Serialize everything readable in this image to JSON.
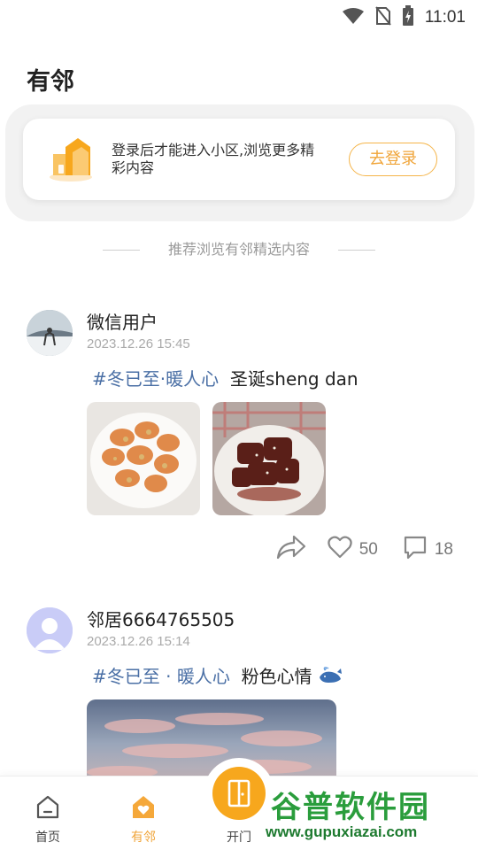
{
  "status_bar": {
    "time": "11:01",
    "icons": [
      "wifi-icon",
      "no-sim-icon",
      "battery-charging-icon"
    ]
  },
  "page": {
    "title": "有邻"
  },
  "login_banner": {
    "text": "登录后才能进入小区,浏览更多精彩内容",
    "button_label": "去登录",
    "accent_color": "#f0a53a"
  },
  "divider": {
    "text": "推荐浏览有邻精选内容"
  },
  "posts": [
    {
      "username": "微信用户",
      "timestamp": "2023.12.26 15:45",
      "hashtag": "#冬已至·暖人心",
      "text": "圣诞sheng dan",
      "images": [
        "shrimp-dish-photo",
        "braised-dish-photo"
      ],
      "likes": "50",
      "comments": "18"
    },
    {
      "username": "邻居6664765505",
      "timestamp": "2023.12.26 15:14",
      "hashtag": "#冬已至 · 暖人心",
      "text": "粉色心情",
      "images": [
        "pink-sky-photo"
      ]
    }
  ],
  "bottom_nav": {
    "items": [
      {
        "label": "首页",
        "icon": "home-icon"
      },
      {
        "label": "有邻",
        "icon": "heart-house-icon"
      },
      {
        "label": "开门",
        "icon": "door-icon"
      }
    ],
    "active_color": "#f0a53a"
  },
  "watermark": {
    "text": "谷普软件园",
    "url": "www.gupuxiazai.com"
  }
}
